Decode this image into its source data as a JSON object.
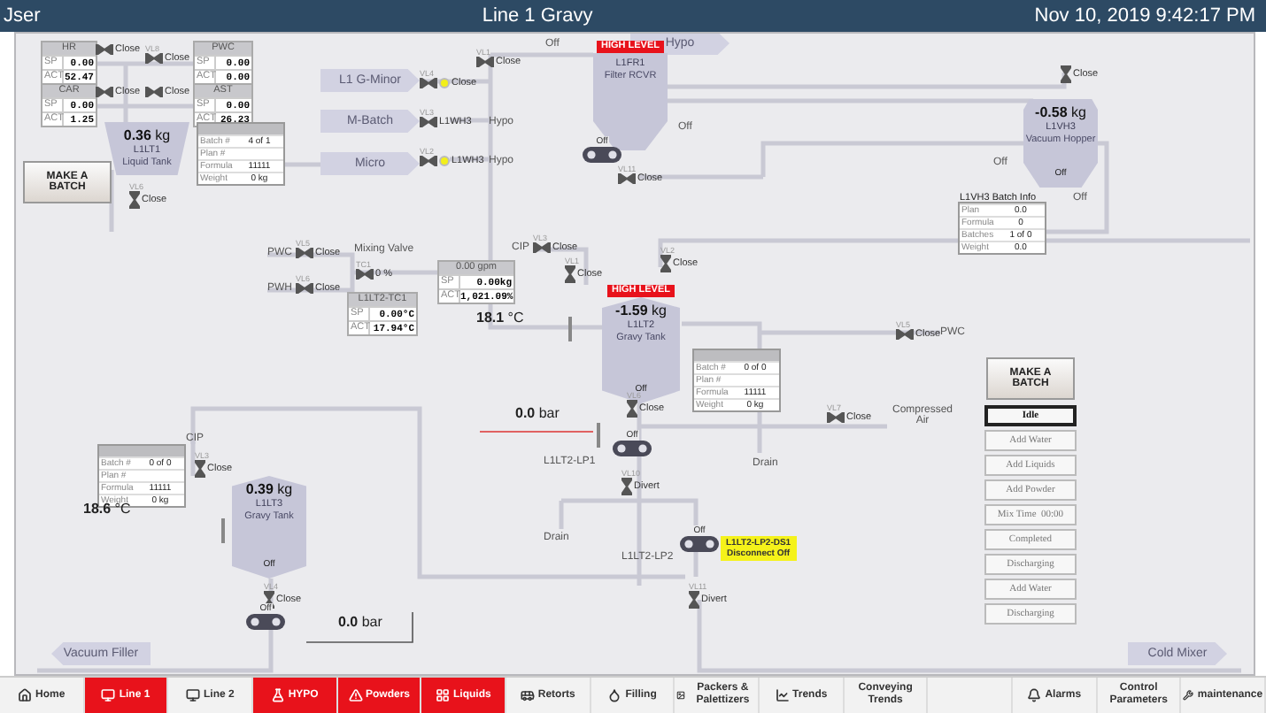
{
  "header": {
    "user": "Jser",
    "title": "Line 1 Gravy",
    "datetime": "Nov 10, 2019 9:42:17 PM"
  },
  "sources": [
    {
      "text": "L1 G-Minor"
    },
    {
      "text": "M-Batch"
    },
    {
      "text": "Micro"
    },
    {
      "text": "Hypo"
    },
    {
      "text": "Vacuum Filler"
    },
    {
      "text": "Cold Mixer"
    }
  ],
  "setpoints": [
    {
      "title": "HR",
      "rows": [
        {
          "label": "SP",
          "value": "0.00"
        },
        {
          "label": "ACT",
          "value": "52.47"
        }
      ]
    },
    {
      "title": "CAR",
      "rows": [
        {
          "label": "SP",
          "value": "0.00"
        },
        {
          "label": "ACT",
          "value": "1.25"
        }
      ]
    },
    {
      "title": "PWC",
      "rows": [
        {
          "label": "SP",
          "value": "0.00"
        },
        {
          "label": "ACT",
          "value": "0.00"
        }
      ]
    },
    {
      "title": "AST",
      "rows": [
        {
          "label": "SP",
          "value": "0.00"
        },
        {
          "label": "ACT",
          "value": "26.23"
        }
      ]
    },
    {
      "title": "0.00 gpm",
      "rows": [
        {
          "label": "SP",
          "value": "0.00kg"
        },
        {
          "label": "ACT",
          "value": "1,021.09%"
        }
      ]
    },
    {
      "title": "L1LT2-TC1",
      "rows": [
        {
          "label": "SP",
          "value": "0.00°C"
        },
        {
          "label": "ACT",
          "value": "17.94°C"
        }
      ]
    }
  ],
  "batch_tables": [
    {
      "rows": [
        {
          "label": "Batch #",
          "value": "4 of 1"
        },
        {
          "label": "Plan #"
        },
        {
          "label": "Formula",
          "value": "11111"
        },
        {
          "label": "Weight",
          "value": "0 kg"
        }
      ]
    },
    {
      "title": "L1VH3 Batch Info",
      "rows": [
        {
          "label": "Plan",
          "value": "0.0"
        },
        {
          "label": "Formula",
          "value": "0"
        },
        {
          "label": "Batches",
          "value": "1 of 0"
        },
        {
          "label": "Weight",
          "value": "0.0"
        }
      ]
    },
    {
      "rows": [
        {
          "label": "Batch #",
          "value": "0 of 0"
        },
        {
          "label": "Plan #"
        },
        {
          "label": "Formula",
          "value": "11111"
        },
        {
          "label": "Weight",
          "value": "0 kg"
        }
      ]
    },
    {
      "rows": [
        {
          "label": "Batch #",
          "value": "0 of 0"
        },
        {
          "label": "Plan #"
        },
        {
          "label": "Formula",
          "value": "11111"
        },
        {
          "label": "Weight",
          "value": "0 kg"
        }
      ]
    }
  ],
  "tanks": [
    {
      "kind": "liquid",
      "weight": "**0.36** kg",
      "name": "L1LT1",
      "type": "Liquid Tank"
    },
    {
      "kind": "filter",
      "name": "L1FR1",
      "type": "Filter RCVR",
      "alarm": "HIGH LEVEL"
    },
    {
      "kind": "gravy",
      "weight": "**-1.59** kg",
      "name": "L1LT2",
      "type": "Gravy Tank",
      "alarm": "HIGH LEVEL",
      "agitator": "Off"
    },
    {
      "kind": "gravy",
      "weight": "**0.39** kg",
      "name": "L1LT3",
      "type": "Gravy Tank",
      "agitator": "Off"
    },
    {
      "kind": "hopper",
      "weight": "**-0.58** kg",
      "name": "L1VH3",
      "type": "Vacuum Hopper",
      "agitator": "Off"
    }
  ],
  "valves": [
    {
      "status": "Close",
      "indicator": false
    },
    {
      "tag": "VL8",
      "status": "Close",
      "indicator": false
    },
    {
      "status": "Close",
      "indicator": false
    },
    {
      "status": "Close",
      "indicator": false
    },
    {
      "tag": "VL4",
      "status": "Close",
      "indicator": true
    },
    {
      "tag": "VL3",
      "status": "L1WH3",
      "indicator": false
    },
    {
      "tag": "VL2",
      "status": "L1WH3",
      "indicator": true
    },
    {
      "tag": "VL1",
      "status": "Close",
      "indicator": false
    },
    {
      "tag": "VL11",
      "status": "Close",
      "indicator": false
    },
    {
      "status": "Close",
      "indicator": false
    },
    {
      "tag": "VL5",
      "status": "Close",
      "indicator": false
    },
    {
      "tag": "VL6",
      "status": "Close",
      "indicator": false
    },
    {
      "tag": "TC1",
      "status": "0 %",
      "indicator": false
    },
    {
      "tag": "VL3",
      "status": "Close",
      "indicator": false
    },
    {
      "tag": "VL1",
      "status": "Close",
      "indicator": false
    },
    {
      "tag": "VL2",
      "status": "Close",
      "indicator": false
    },
    {
      "tag": "VL5",
      "status": "Close",
      "indicator": false
    },
    {
      "tag": "VL6",
      "status": "Close",
      "indicator": false
    },
    {
      "tag": "VL7",
      "status": "Close",
      "indicator": false
    },
    {
      "tag": "VL3",
      "status": "Close",
      "indicator": false
    },
    {
      "tag": "VL4",
      "status": "Close",
      "indicator": false
    },
    {
      "tag": "VL10",
      "status": "Divert",
      "indicator": false
    },
    {
      "tag": "VL11",
      "status": "Divert",
      "indicator": false
    },
    {
      "tag": "VL6",
      "status": "Close",
      "indicator": false
    }
  ],
  "pumps": [
    {
      "status": "Off"
    },
    {
      "status": "Off"
    },
    {
      "status": "Off"
    },
    {
      "status": "Off"
    }
  ],
  "texts": [
    {
      "text": "Hypo"
    },
    {
      "text": "Hypo"
    },
    {
      "text": "Off"
    },
    {
      "text": "Off"
    },
    {
      "text": "PWC"
    },
    {
      "text": "PWH"
    },
    {
      "text": "Mixing Valve"
    },
    {
      "text": "CIP"
    },
    {
      "text": "**18.1** °C"
    },
    {
      "text": "Drain"
    },
    {
      "text": "PWC"
    },
    {
      "text": "**0.0** bar"
    },
    {
      "text": "Compressed Air"
    },
    {
      "text": "L1LT2-LP1"
    },
    {
      "text": "CIP"
    },
    {
      "text": "**18.6** °C"
    },
    {
      "text": "Drain"
    },
    {
      "text": "L1LT2-LP2"
    },
    {
      "text": "**0.0** bar"
    },
    {
      "text": "Off"
    },
    {
      "text": "Off"
    }
  ],
  "warning": {
    "lines": [
      "L1LT2-LP2-DS1",
      "Disconnect Off"
    ]
  },
  "make_batch_buttons": [
    {
      "label": "MAKE A BATCH"
    },
    {
      "label": "MAKE A BATCH"
    }
  ],
  "sequence": [
    {
      "label": "Idle",
      "selected": true
    },
    {
      "label": "Add Water",
      "selected": false
    },
    {
      "label": "Add Liquids",
      "selected": false
    },
    {
      "label": "Add Powder",
      "selected": false
    },
    {
      "label": "Mix Time  00:00",
      "selected": false
    },
    {
      "label": "Completed",
      "selected": false
    },
    {
      "label": "Discharging",
      "selected": false
    },
    {
      "label": "Add Water",
      "selected": false
    },
    {
      "label": "Discharging",
      "selected": false
    }
  ],
  "nav": [
    {
      "label": "Home",
      "alarm": false
    },
    {
      "label": "Line 1",
      "alarm": true
    },
    {
      "label": "Line 2",
      "alarm": false
    },
    {
      "label": "HYPO",
      "alarm": true
    },
    {
      "label": "Powders",
      "alarm": true
    },
    {
      "label": "Liquids",
      "alarm": true
    },
    {
      "label": "Retorts",
      "alarm": false
    },
    {
      "label": "Filling",
      "alarm": false
    },
    {
      "label": "Packers & Palettizers",
      "alarm": false
    },
    {
      "label": "Trends",
      "alarm": false
    },
    {
      "label": "Conveying Trends",
      "alarm": false
    },
    {
      "alarm": false
    },
    {
      "label": "Alarms",
      "alarm": false
    },
    {
      "label": "Control Parameters",
      "alarm": false
    },
    {
      "label": "maintenance",
      "alarm": false
    }
  ]
}
